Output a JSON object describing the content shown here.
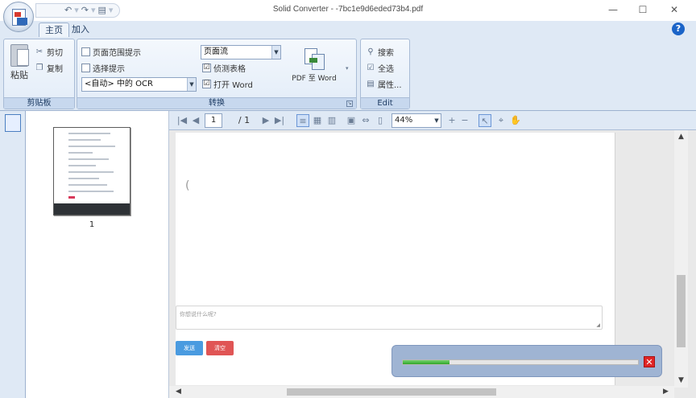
{
  "window": {
    "title": "Solid Converter - -7bc1e9d6eded73b4.pdf",
    "controls": {
      "minimize": "—",
      "maximize": "☐",
      "close": "✕"
    }
  },
  "quick_access": {
    "undo": "↶",
    "redo": "↷",
    "save": "▤",
    "dropdown": "▾"
  },
  "tabs": [
    {
      "label": "主页",
      "active": true
    },
    {
      "label": "加入",
      "active": false
    }
  ],
  "help": "?",
  "ribbon": {
    "clipboard": {
      "label": "剪贴板",
      "paste": "粘贴",
      "cut": "剪切",
      "copy": "复制"
    },
    "convert": {
      "label": "转换",
      "page_range_hint": "页面范围提示",
      "select_hint": "选择提示",
      "ocr_combo": "<自动> 中的 OCR",
      "layout_combo": "页面流",
      "detect_tables": "侦测表格",
      "open_word": "打开 Word",
      "pdf_to_word": "PDF 至 Word",
      "detect_tables_checked": "☑",
      "open_word_checked": "☑"
    },
    "edit": {
      "label": "Edit",
      "search": "搜索",
      "select_all": "全选",
      "properties": "属性..."
    }
  },
  "thumbnails": {
    "page_label": "1"
  },
  "viewer_toolbar": {
    "first": "|◀",
    "prev": "◀",
    "page_number": "1",
    "page_total": "/ 1",
    "next": "▶",
    "last": "▶|",
    "zoom": "44%",
    "zoom_in": "+",
    "zoom_out": "−"
  },
  "document": {
    "paren": "(",
    "input_placeholder": "你想说什么呢?",
    "send_button": "发送",
    "clear_button": "清空"
  },
  "progress": {
    "fraction": 0.2
  },
  "colors": {
    "accent": "#1b64c8",
    "send": "#4a9be0",
    "clear": "#e05555",
    "progress": "#2fa52a"
  }
}
